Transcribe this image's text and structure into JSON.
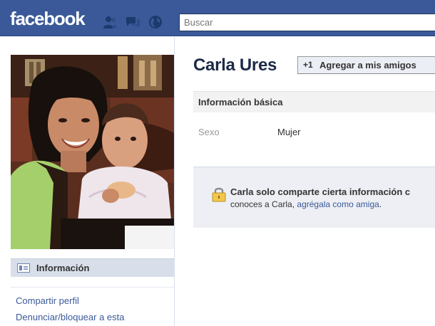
{
  "header": {
    "logo": "facebook",
    "search_placeholder": "Buscar",
    "icons": [
      "friend-requests-icon",
      "messages-icon",
      "notifications-icon"
    ]
  },
  "sidebar": {
    "info_tab_label": "Información",
    "links": [
      "Compartir perfil",
      "Denunciar/bloquear a esta"
    ]
  },
  "profile": {
    "name": "Carla Ures",
    "add_friend_label": "Agregar a mis amigos",
    "add_friend_icon": "+1"
  },
  "basic_info": {
    "title": "Información básica",
    "fields": [
      {
        "label": "Sexo",
        "value": "Mujer"
      }
    ]
  },
  "notice": {
    "line1": "Carla solo comparte cierta información c",
    "line2_prefix": "conoces a Carla, ",
    "line2_link": "agrégala como amiga",
    "line2_suffix": "."
  },
  "colors": {
    "brand_blue": "#3b5998",
    "link_blue": "#3b5998",
    "notice_bg": "#edeff4"
  }
}
